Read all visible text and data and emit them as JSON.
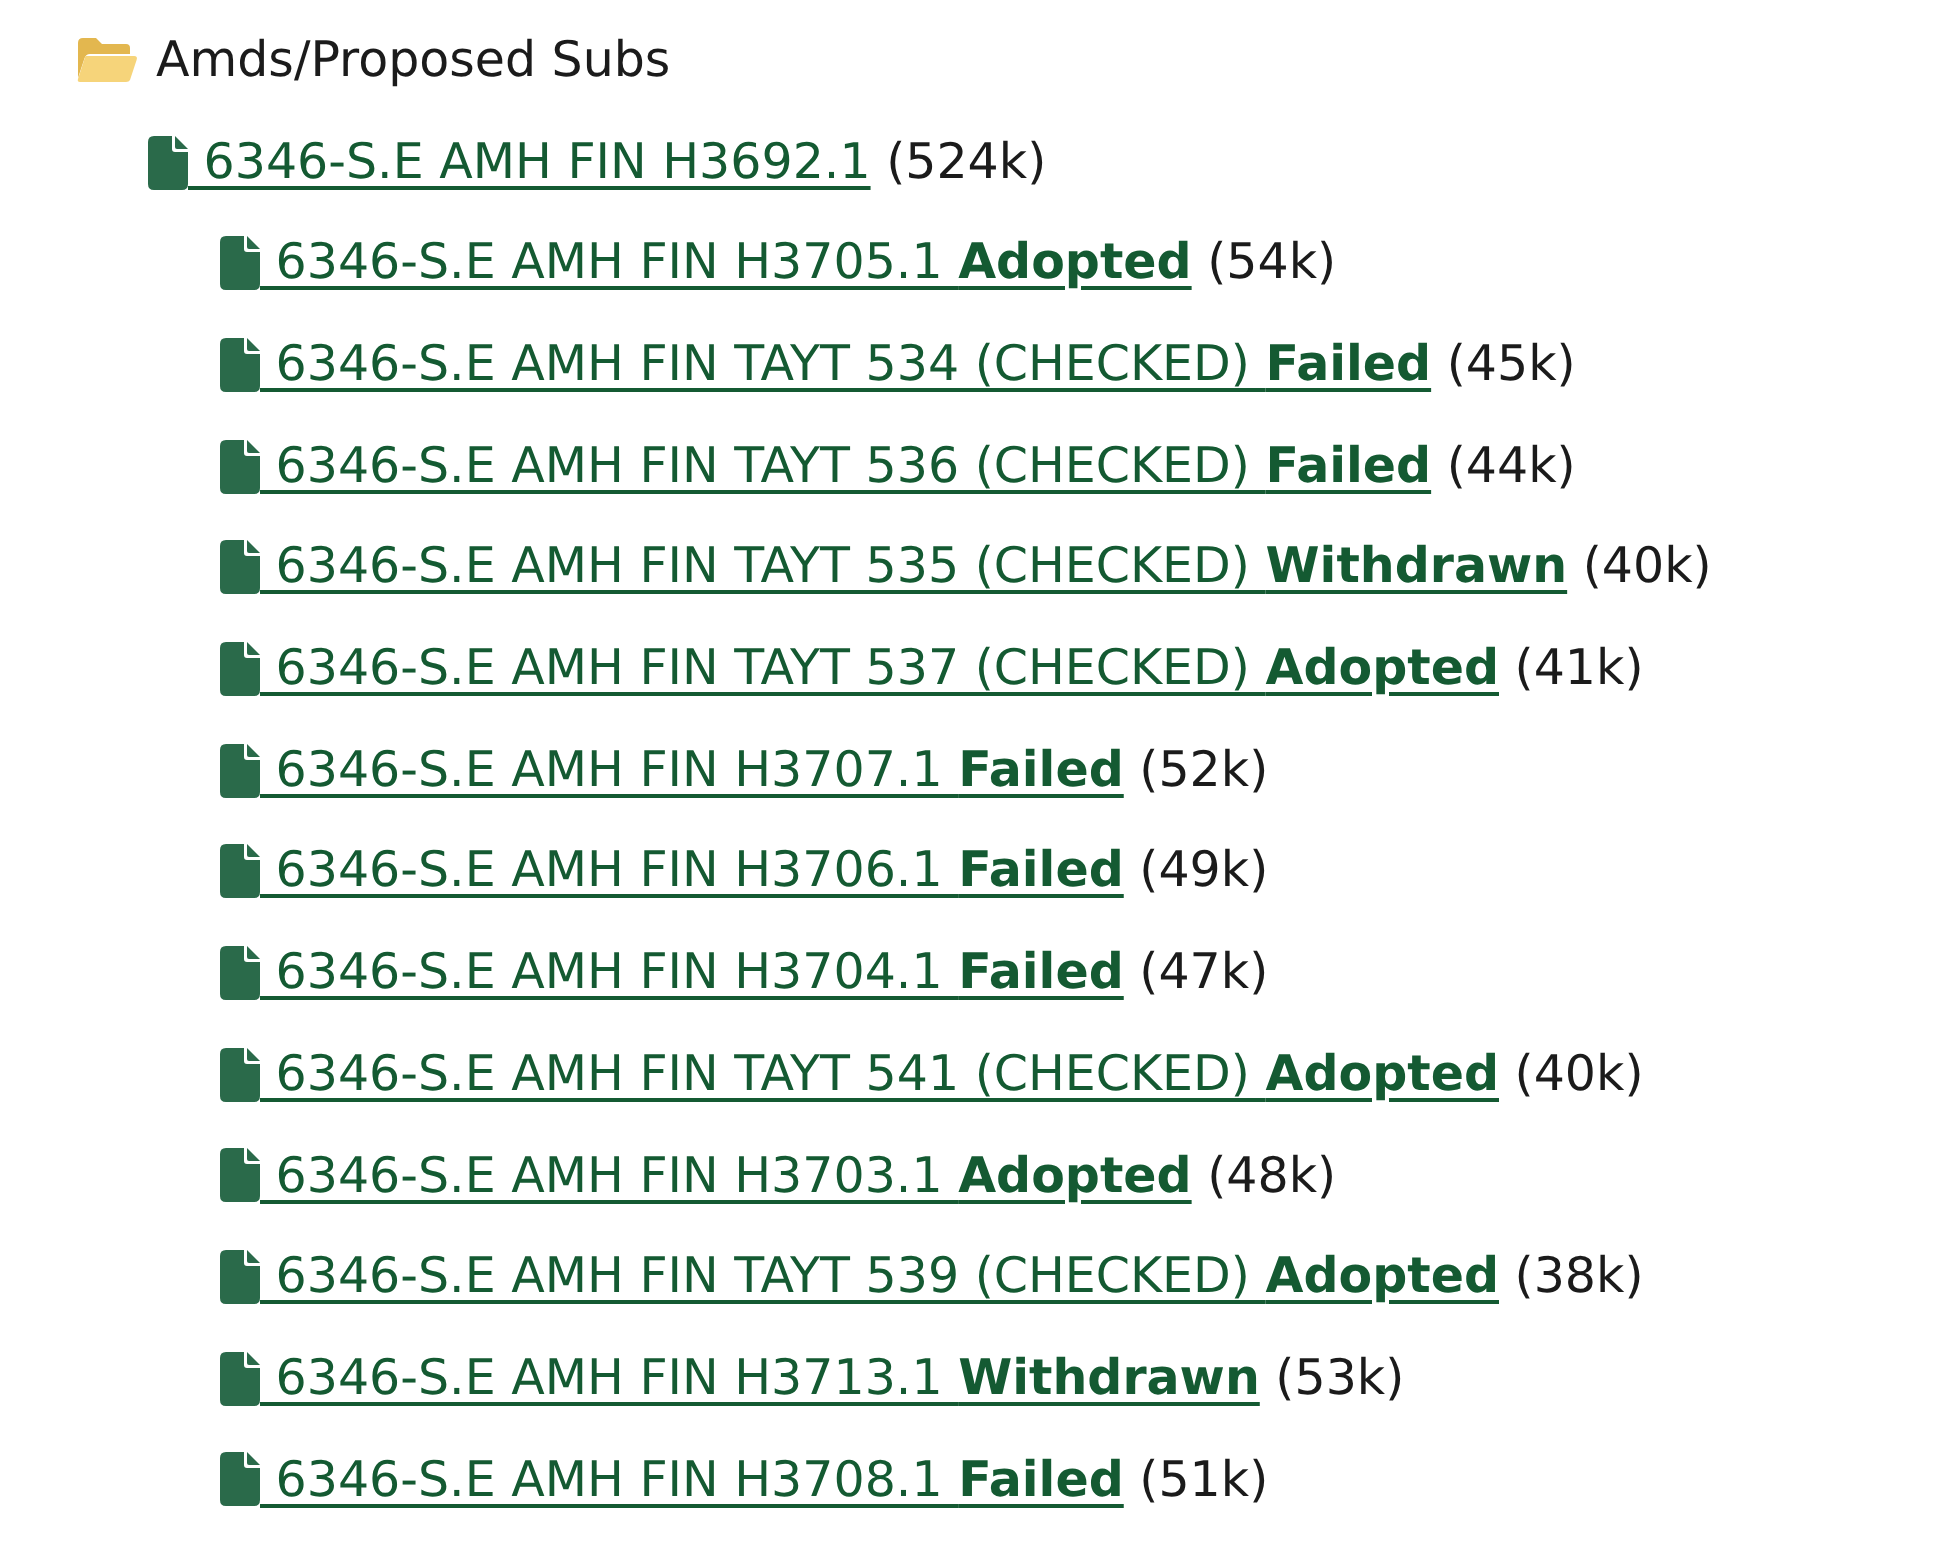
{
  "folder": {
    "name": "Amds/Proposed Subs",
    "expanded": true,
    "files": [
      {
        "title": "6346-S.E AMH FIN H3692.1",
        "size": "(524k)",
        "children": [
          {
            "title": "6346-S.E AMH FIN H3705.1",
            "status": "Adopted",
            "size": "(54k)"
          },
          {
            "title": "6346-S.E AMH FIN TAYT 534 (CHECKED)",
            "status": "Failed",
            "size": "(45k)"
          },
          {
            "title": "6346-S.E AMH FIN TAYT 536 (CHECKED)",
            "status": "Failed",
            "size": "(44k)"
          },
          {
            "title": "6346-S.E AMH FIN TAYT 535 (CHECKED)",
            "status": "Withdrawn",
            "size": "(40k)"
          },
          {
            "title": "6346-S.E AMH FIN TAYT 537 (CHECKED)",
            "status": "Adopted",
            "size": "(41k)"
          },
          {
            "title": "6346-S.E AMH FIN H3707.1",
            "status": "Failed",
            "size": "(52k)"
          },
          {
            "title": "6346-S.E AMH FIN H3706.1",
            "status": "Failed",
            "size": "(49k)"
          },
          {
            "title": "6346-S.E AMH FIN H3704.1",
            "status": "Failed",
            "size": "(47k)"
          },
          {
            "title": "6346-S.E AMH FIN TAYT 541 (CHECKED)",
            "status": "Adopted",
            "size": "(40k)"
          },
          {
            "title": "6346-S.E AMH FIN H3703.1",
            "status": "Adopted",
            "size": "(48k)"
          },
          {
            "title": "6346-S.E AMH FIN TAYT 539 (CHECKED)",
            "status": "Adopted",
            "size": "(38k)"
          },
          {
            "title": "6346-S.E AMH FIN H3713.1",
            "status": "Withdrawn",
            "size": "(53k)"
          },
          {
            "title": "6346-S.E AMH FIN H3708.1",
            "status": "Failed",
            "size": "(51k)"
          }
        ]
      }
    ]
  }
}
